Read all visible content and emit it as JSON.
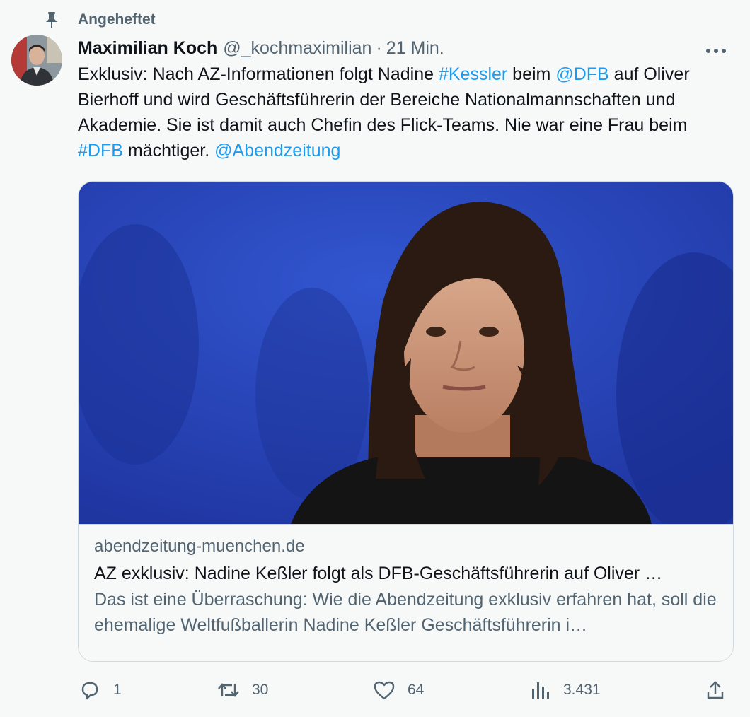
{
  "pinned": {
    "label": "Angeheftet",
    "icon": "pin-icon"
  },
  "author": {
    "name": "Maximilian Koch",
    "handle": "@_kochmaximilian",
    "separator": "·",
    "time": "21 Min."
  },
  "tweet": {
    "t1": "Exklusiv: Nach AZ-Informationen folgt Nadine ",
    "hashtag_kessler": "#Kessler",
    "t2": " beim ",
    "mention_dfb": "@DFB",
    "t3": " auf Oliver Bierhoff und wird Geschäftsführerin der Bereiche Nationalmannschaften und Akademie. Sie ist damit auch Chefin des Flick-Teams. Nie war eine Frau beim ",
    "hashtag_dfb": "#DFB",
    "t4": " mächtiger. ",
    "mention_az": "@Abendzeitung"
  },
  "card": {
    "domain": "abendzeitung-muenchen.de",
    "title": "AZ exklusiv: Nadine Keßler folgt als DFB-Geschäftsführerin auf Oliver …",
    "description": "Das ist eine Überraschung: Wie die Abendzeitung exklusiv erfahren hat, soll die ehemalige Weltfußballerin Nadine Keßler Geschäftsführerin i…"
  },
  "actions": {
    "reply_count": "1",
    "retweet_count": "30",
    "like_count": "64",
    "views_count": "3.431"
  },
  "colors": {
    "link": "#1d9bf0",
    "secondary_text": "#536471",
    "background": "#f7f9f9",
    "card_image_blue": "#2a48b8"
  }
}
